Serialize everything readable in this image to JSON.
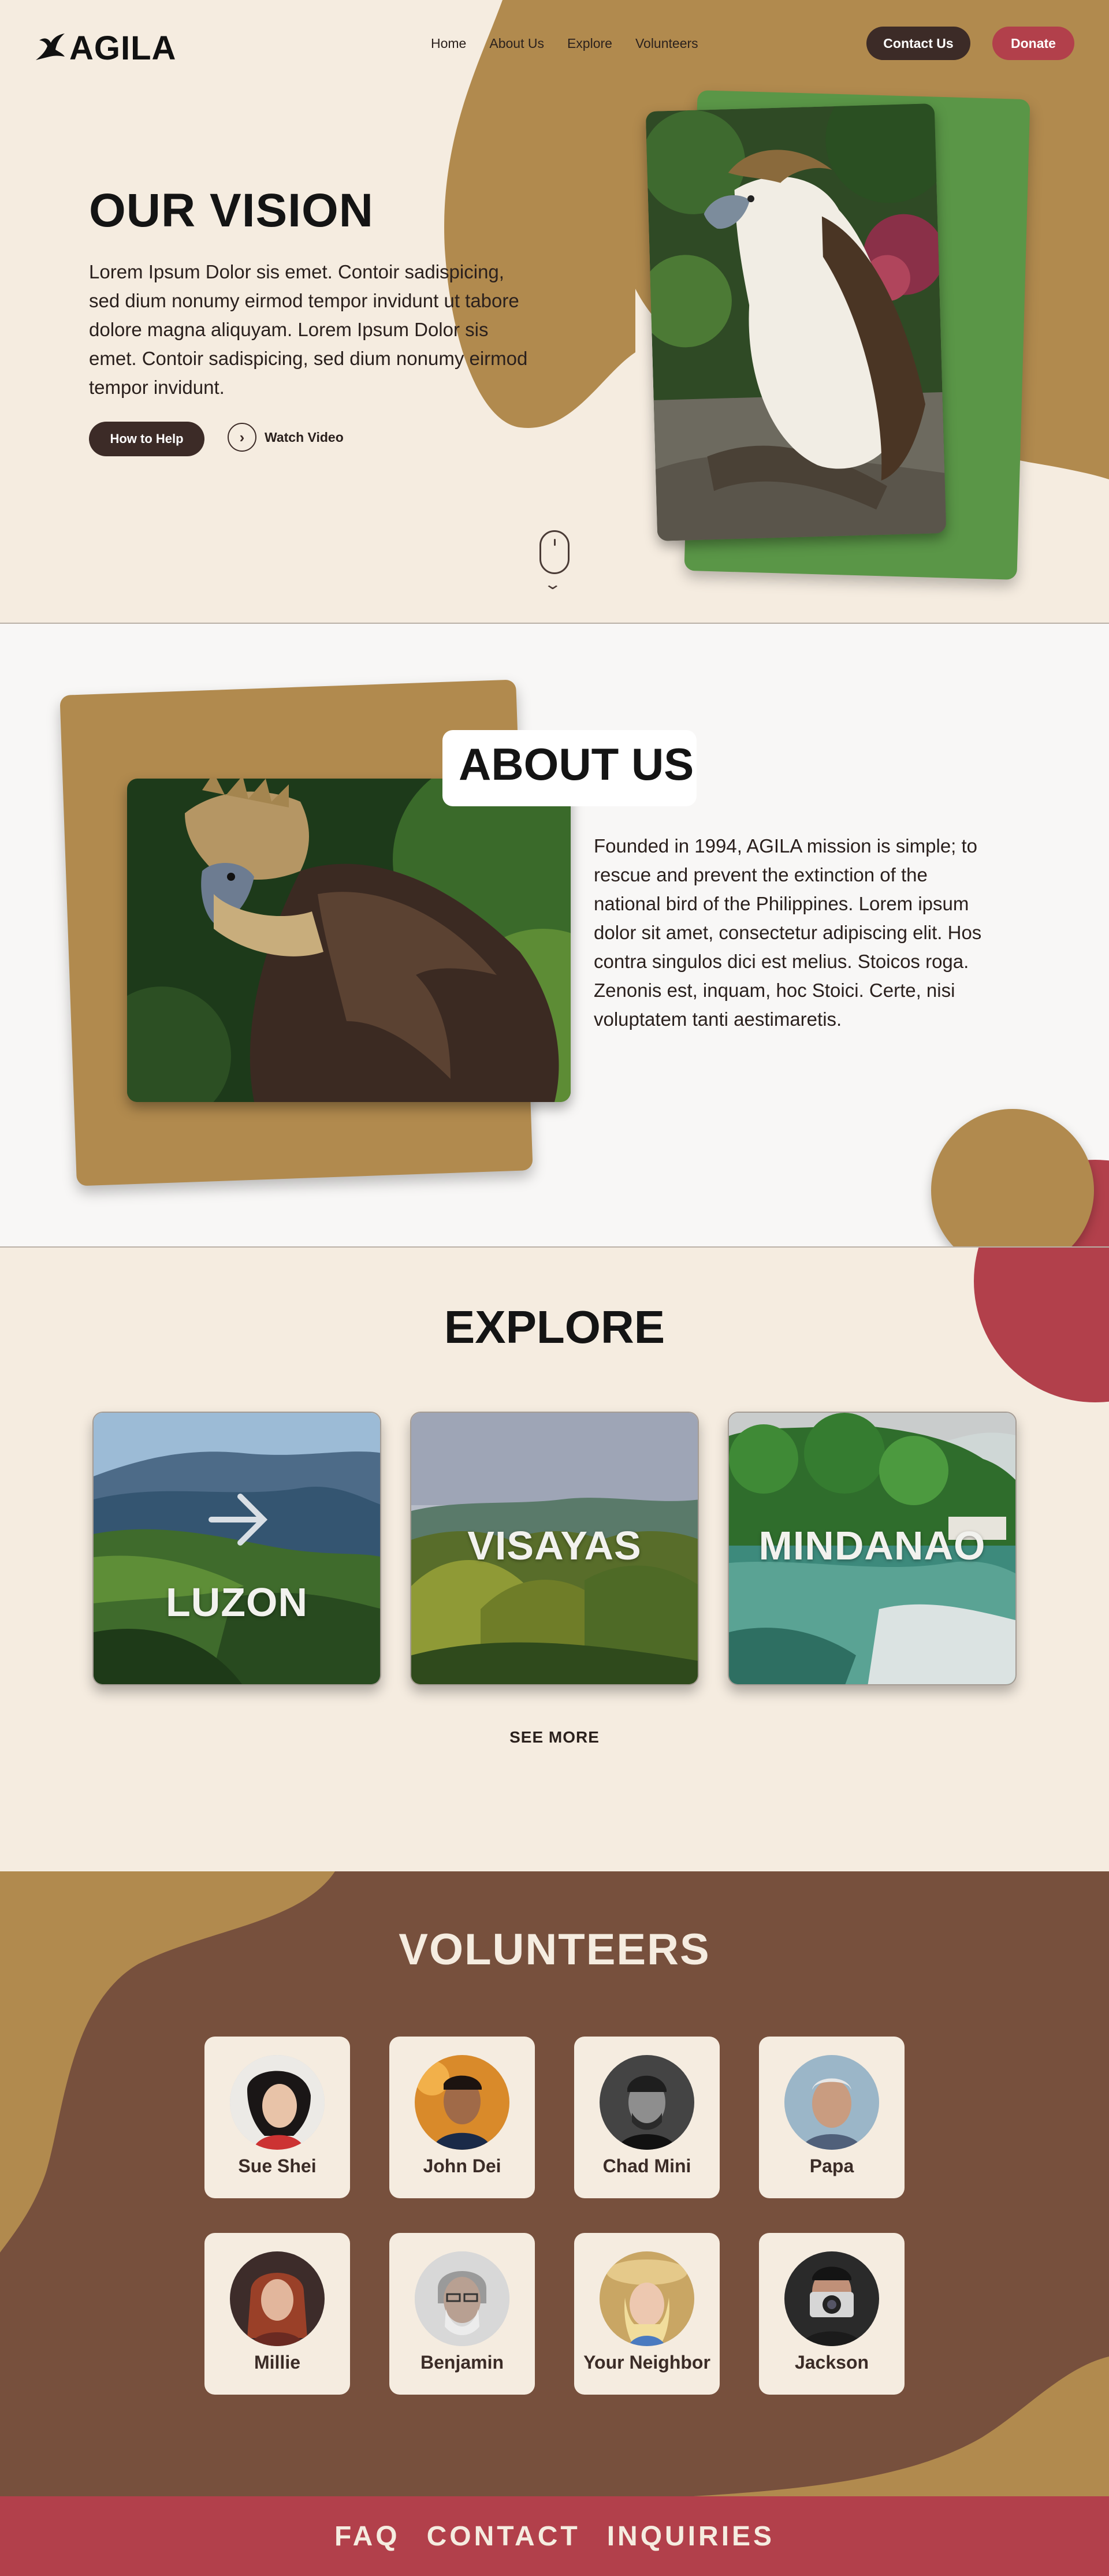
{
  "brand": {
    "name": "AGILA",
    "logo_icon": "eagle-icon"
  },
  "nav": {
    "links": [
      "Home",
      "About Us",
      "Explore",
      "Volunteers"
    ],
    "contact_label": "Contact Us",
    "donate_label": "Donate"
  },
  "hero": {
    "title": "OUR VISION",
    "text": "Lorem Ipsum Dolor sis emet. Contoir sadispicing, sed dium nonumy eirmod tempor invidunt ut tabore dolore magna aliquyam. Lorem Ipsum Dolor sis emet. Contoir sadispicing, sed dium nonumy eirmod tempor invidunt.",
    "help_label": "How to Help",
    "watch_label": "Watch Video",
    "scroll_icon": "mouse-scroll-icon"
  },
  "about": {
    "title": "ABOUT US",
    "text": "Founded in 1994, AGILA mission is simple; to rescue and prevent the extinction of the national bird of the Philippines. Lorem ipsum dolor sit amet, consectetur adipiscing elit. Hos contra singulos dici est melius. Stoicos roga. Zenonis est, inquam, hoc Stoici. Certe, nisi voluptatem tanti aestimaretis."
  },
  "explore": {
    "title": "EXPLORE",
    "regions": [
      "LUZON",
      "VISAYAS",
      "MINDANAO"
    ],
    "see_more_label": "SEE MORE"
  },
  "volunteers": {
    "title": "VOLUNTEERS",
    "people": [
      "Sue Shei",
      "John Dei",
      "Chad Mini",
      "Papa",
      "Millie",
      "Benjamin",
      "Your Neighbor",
      "Jackson"
    ]
  },
  "footer": {
    "links": [
      "FAQ",
      "CONTACT",
      "INQUIRIES"
    ]
  },
  "colors": {
    "tan": "#b18a4e",
    "cream": "#f5ece0",
    "dark_brown": "#3c2b27",
    "red": "#b2404b",
    "green": "#5a9647",
    "brown": "#77503d"
  }
}
